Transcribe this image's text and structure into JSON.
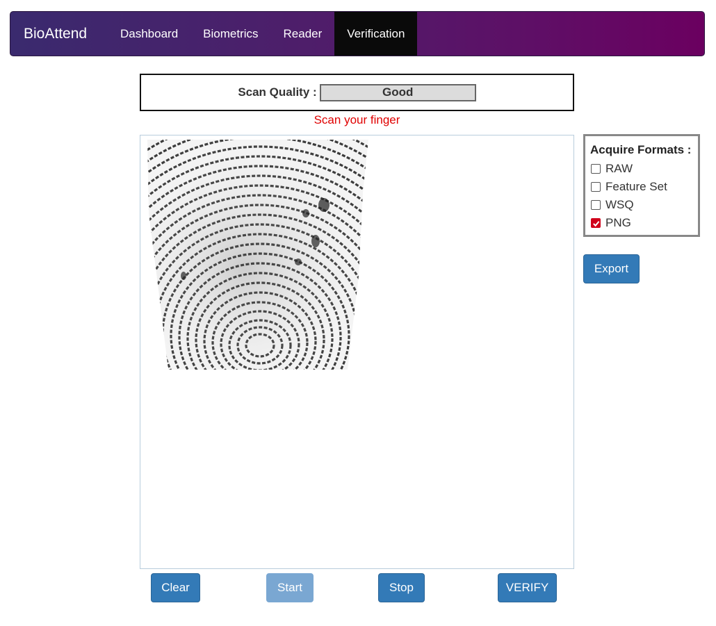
{
  "navbar": {
    "brand": "BioAttend",
    "items": [
      {
        "label": "Dashboard",
        "active": false
      },
      {
        "label": "Biometrics",
        "active": false
      },
      {
        "label": "Reader",
        "active": false
      },
      {
        "label": "Verification",
        "active": true
      }
    ],
    "gradient_start": "#3a2a6e",
    "gradient_end": "#6b0060"
  },
  "scan": {
    "quality_label": "Scan Quality :",
    "quality_value": "Good",
    "message": "Scan your finger",
    "message_color": "#e00000"
  },
  "formats": {
    "title": "Acquire Formats :",
    "options": [
      {
        "label": "RAW",
        "checked": false
      },
      {
        "label": "Feature Set",
        "checked": false
      },
      {
        "label": "WSQ",
        "checked": false
      },
      {
        "label": "PNG",
        "checked": true
      }
    ]
  },
  "buttons": {
    "export": "Export",
    "clear": "Clear",
    "start": "Start",
    "stop": "Stop",
    "verify": "VERIFY"
  },
  "colors": {
    "button_primary": "#337ab7",
    "button_disabled": "#7aa7d2"
  }
}
